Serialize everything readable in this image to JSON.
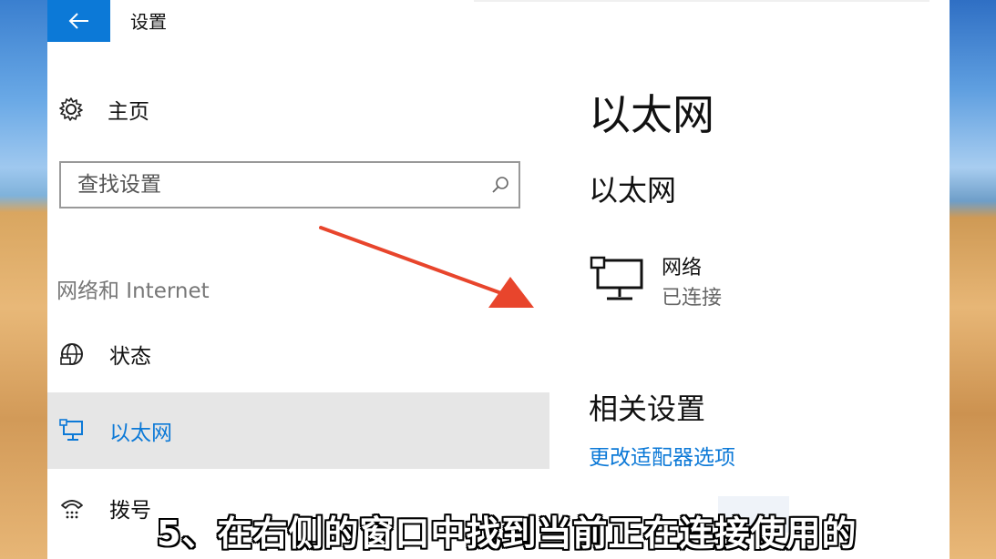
{
  "window": {
    "title": "设置"
  },
  "sidebar": {
    "home_label": "主页",
    "search_placeholder": "查找设置",
    "section_header": "网络和 Internet",
    "items": [
      {
        "label": "状态",
        "icon": "globe-icon",
        "selected": false
      },
      {
        "label": "以太网",
        "icon": "ethernet-monitor-icon",
        "selected": true
      },
      {
        "label": "拨号",
        "icon": "dialup-phone-icon",
        "selected": false
      }
    ]
  },
  "main": {
    "page_title": "以太网",
    "sub_title": "以太网",
    "network": {
      "name": "网络",
      "status": "已连接"
    },
    "related_title": "相关设置",
    "links": [
      "更改适配器选项"
    ]
  },
  "caption": "5、在右侧的窗口中找到当前正在连接使用的",
  "colors": {
    "accent": "#0c79d7",
    "selected_bg": "#e6e6e6",
    "arrow": "#e8452c"
  }
}
